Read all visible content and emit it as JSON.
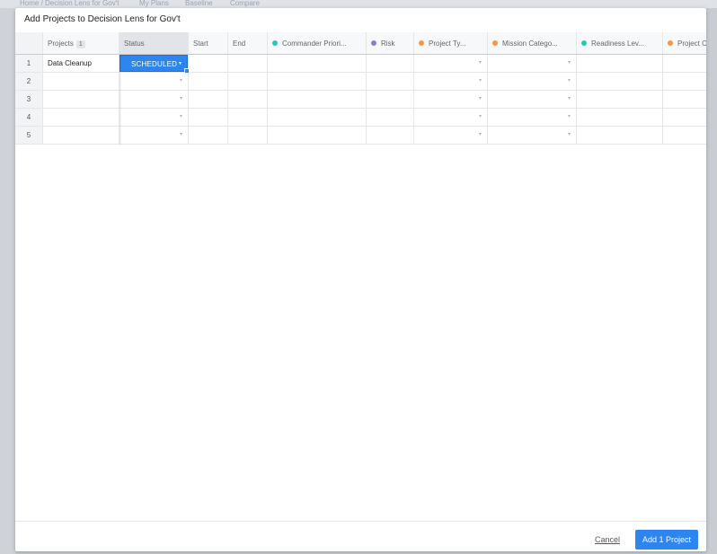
{
  "background": {
    "tabs": [
      "Home / Decision Lens for Gov't",
      "My Plans",
      "Baseline",
      "Compare"
    ]
  },
  "modal": {
    "title": "Add Projects to Decision Lens for Gov't",
    "columns": [
      {
        "label": "Projects",
        "badge": "1"
      },
      {
        "label": "Status"
      },
      {
        "label": "Start"
      },
      {
        "label": "End"
      },
      {
        "label": "Commander Priori...",
        "dot": "#2ec4b6"
      },
      {
        "label": "Risk",
        "dot": "#8a7fd1"
      },
      {
        "label": "Project Ty...",
        "dot": "#f5954a"
      },
      {
        "label": "Mission Catego...",
        "dot": "#f5954a"
      },
      {
        "label": "Readiness Lev...",
        "dot": "#2ec4b6"
      },
      {
        "label": "Project C",
        "dot": "#f5954a"
      }
    ],
    "rows": [
      {
        "num": "1",
        "project": "Data Cleanup",
        "status": "SCHEDULED"
      },
      {
        "num": "2",
        "project": "",
        "status": ""
      },
      {
        "num": "3",
        "project": "",
        "status": ""
      },
      {
        "num": "4",
        "project": "",
        "status": ""
      },
      {
        "num": "5",
        "project": "",
        "status": ""
      }
    ],
    "chevron": "▾",
    "cancel_label": "Cancel",
    "add_label": "Add 1 Project"
  },
  "colors": {
    "accent": "#2d86f0",
    "overlay": "#c9cdd2"
  }
}
